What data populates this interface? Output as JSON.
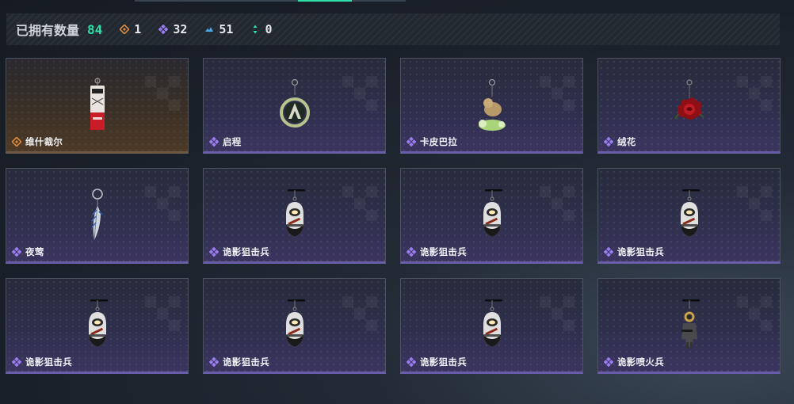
{
  "header": {
    "owned_label": "已拥有数量",
    "owned_total": "84",
    "rarity_counts": [
      {
        "icon": "gold-rarity-icon",
        "value": "1",
        "color": "#e08a3c"
      },
      {
        "icon": "purple-rarity-icon",
        "value": "32",
        "color": "#9a7cf0"
      },
      {
        "icon": "blue-rarity-icon",
        "value": "51",
        "color": "#4aa7e6"
      },
      {
        "icon": "green-rarity-icon",
        "value": "0",
        "color": "#2fe0a8"
      }
    ]
  },
  "colors": {
    "accent": "#2fe0a8",
    "gold_rarity": "#e08a3c",
    "purple_rarity": "#9a7cf0"
  },
  "items": [
    {
      "label": "维什裁尔",
      "rarity": "gold",
      "icon": "red-white-tag-charm-icon"
    },
    {
      "label": "启程",
      "rarity": "purple",
      "icon": "ring-emblem-charm-icon"
    },
    {
      "label": "卡皮巴拉",
      "rarity": "purple",
      "icon": "capybara-charm-icon"
    },
    {
      "label": "绒花",
      "rarity": "purple",
      "icon": "red-rose-charm-icon"
    },
    {
      "label": "夜莺",
      "rarity": "purple",
      "icon": "feather-charm-icon"
    },
    {
      "label": "诡影狙击兵",
      "rarity": "purple",
      "icon": "sniper-figure-charm-icon"
    },
    {
      "label": "诡影狙击兵",
      "rarity": "purple",
      "icon": "sniper-figure-charm-icon"
    },
    {
      "label": "诡影狙击兵",
      "rarity": "purple",
      "icon": "sniper-figure-charm-icon"
    },
    {
      "label": "诡影狙击兵",
      "rarity": "purple",
      "icon": "sniper-figure-charm-icon"
    },
    {
      "label": "诡影狙击兵",
      "rarity": "purple",
      "icon": "sniper-figure-charm-icon"
    },
    {
      "label": "诡影狙击兵",
      "rarity": "purple",
      "icon": "sniper-figure-charm-icon"
    },
    {
      "label": "诡影喷火兵",
      "rarity": "purple",
      "icon": "flamethrower-figure-charm-icon"
    }
  ]
}
